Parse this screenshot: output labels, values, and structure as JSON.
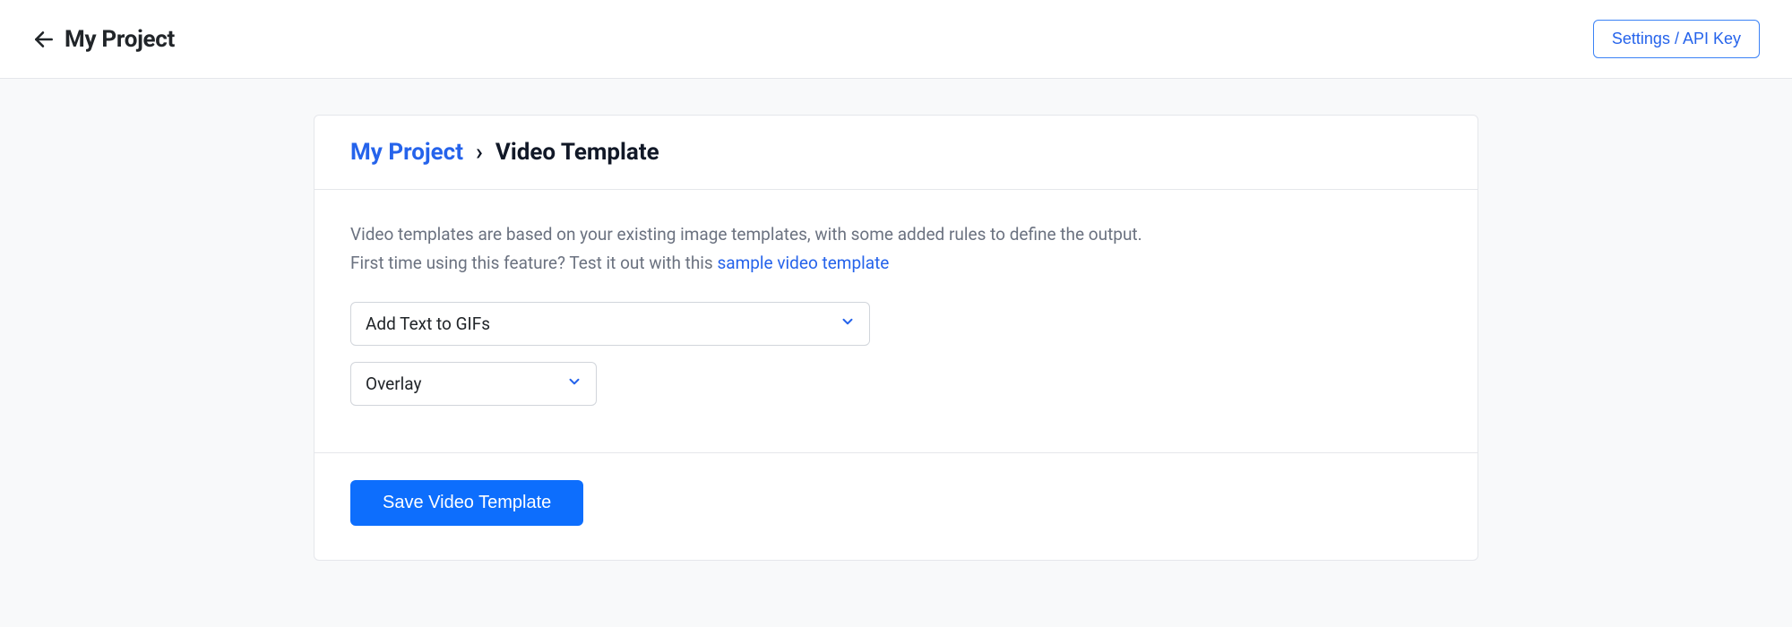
{
  "topbar": {
    "project_title": "My Project",
    "settings_label": "Settings / API Key"
  },
  "breadcrumb": {
    "root": "My Project",
    "separator": "›",
    "current": "Video Template"
  },
  "body": {
    "desc_line1": "Video templates are based on your existing image templates, with some added rules to define the output.",
    "desc_line2_prefix": "First time using this feature? Test it out with this ",
    "desc_link": "sample video template",
    "select_template_value": "Add Text to GIFs",
    "select_mode_value": "Overlay"
  },
  "footer": {
    "save_label": "Save Video Template"
  }
}
